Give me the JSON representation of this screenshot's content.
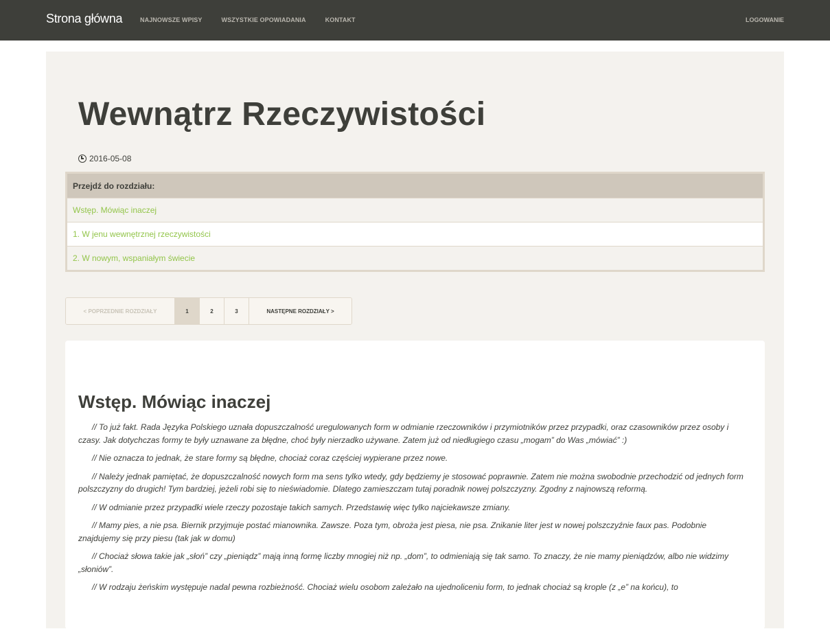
{
  "navbar": {
    "brand": "Strona główna",
    "links": [
      "NAJNOWSZE WPISY",
      "WSZYSTKIE OPOWIADANIA",
      "KONTAKT"
    ],
    "login": "LOGOWANIE"
  },
  "story": {
    "title": "Wewnątrz Rzeczywistości",
    "date": "2016-05-08"
  },
  "toc": {
    "heading": "Przejdź do rozdziału:",
    "chapters": [
      "Wstęp. Mówiąc inaczej",
      "1. W jenu wewnętrznej rzeczywistości",
      "2. W nowym, wspaniałym świecie"
    ]
  },
  "pager": {
    "prev": "< POPRZEDNIE ROZDZIAŁY",
    "pages": [
      "1",
      "2",
      "3"
    ],
    "active_page": "1",
    "next": "NASTĘPNE ROZDZIAŁY >"
  },
  "chapter": {
    "title": "Wstęp. Mówiąc inaczej",
    "paragraphs": [
      "// To już fakt. Rada Języka Polskiego uznała dopuszczalność uregulowanych form w odmianie rzeczowników i przymiotników przez przypadki, oraz czasowników przez osoby i czasy. Jak dotychczas formy te były uznawane za błędne, choć były nierzadko używane. Zatem już od niedługiego czasu „mogam” do Was „mówiać” :)",
      "// Nie oznacza to jednak, że stare formy są błędne, chociaż coraz częściej wypierane przez nowe.",
      "// Należy jednak pamiętać, że dopuszczalność nowych form ma sens tylko wtedy, gdy będziemy je stosować poprawnie. Zatem nie można swobodnie przechodzić od jednych form polszczyzny do drugich! Tym bardziej, jeżeli robi się to nieświadomie. Dlatego zamieszczam tutaj poradnik nowej polszczyzny. Zgodny z najnowszą reformą.",
      "// W odmianie przez przypadki wiele rzeczy pozostaje takich samych. Przedstawię więc tylko najciekawsze zmiany.",
      "// Mamy pies, a nie psa. Biernik przyjmuje postać mianownika. Zawsze. Poza tym, obroża jest piesa, nie psa. Znikanie liter jest w nowej polszczyźnie faux pas. Podobnie znajdujemy się przy piesu (tak jak w domu)",
      "// Chociaż słowa takie jak „słoń” czy „pieniądz” mają inną formę liczby mnogiej niż np. „dom”, to odmieniają się tak samo. To znaczy, że nie mamy pieniądzów, albo nie widzimy „słoniów”.",
      "// W rodzaju żeńskim występuje nadal pewna rozbieżność. Chociaż wielu osobom zależało na ujednoliceniu form, to jednak chociaż są krople (z „e” na końcu), to"
    ]
  }
}
